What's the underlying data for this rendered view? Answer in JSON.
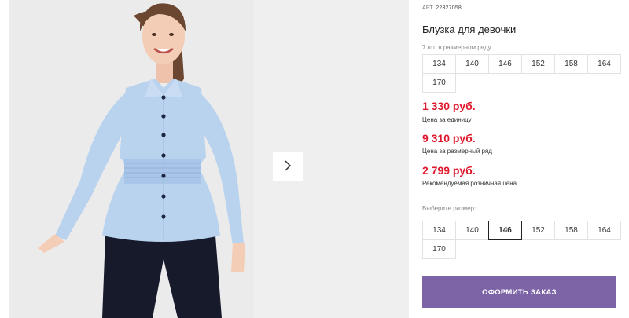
{
  "product": {
    "article_label": "АРТ.",
    "article_number": "22327058",
    "title": "Блузка для девочки",
    "size_row_caption": "7 шт. в размерном ряду",
    "size_row": [
      "134",
      "140",
      "146",
      "152",
      "158",
      "164",
      "170"
    ],
    "prices": [
      {
        "value": "1 330 руб.",
        "label": "Цена за единицу"
      },
      {
        "value": "9 310 руб.",
        "label": "Цена за размерный ряд"
      },
      {
        "value": "2 799 руб.",
        "label": "Рекомендуемая розничная цена"
      }
    ],
    "choose_size_caption": "Выберите размер:",
    "choose_sizes": [
      "134",
      "140",
      "146",
      "152",
      "158",
      "164",
      "170"
    ],
    "selected_size": "146",
    "order_button": "ОФОРМИТЬ ЗАКАЗ"
  },
  "gallery": {
    "next_icon": "chevron-right-icon"
  },
  "colors": {
    "price_red": "#e0182d",
    "order_purple": "#7c64a6",
    "shirt_blue": "#b9d3ef"
  }
}
